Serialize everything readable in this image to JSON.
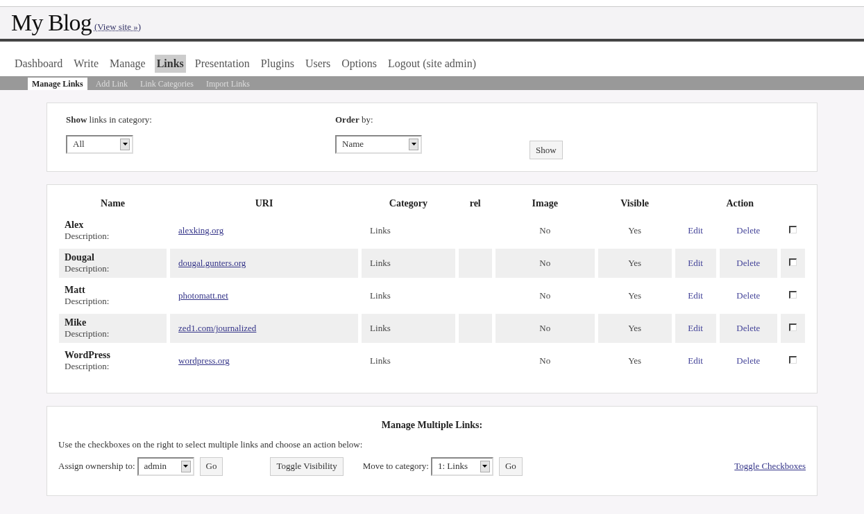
{
  "header": {
    "title": "My Blog",
    "view_site_link": "(View site »)"
  },
  "nav": [
    {
      "label": "Dashboard",
      "selected": false
    },
    {
      "label": "Write",
      "selected": false
    },
    {
      "label": "Manage",
      "selected": false
    },
    {
      "label": "Links",
      "selected": true
    },
    {
      "label": "Presentation",
      "selected": false
    },
    {
      "label": "Plugins",
      "selected": false
    },
    {
      "label": "Users",
      "selected": false
    },
    {
      "label": "Options",
      "selected": false
    },
    {
      "label": "Logout (site admin)",
      "selected": false
    }
  ],
  "subnav": [
    {
      "label": "Manage Links",
      "selected": true
    },
    {
      "label": "Add Link",
      "selected": false
    },
    {
      "label": "Link Categories",
      "selected": false
    },
    {
      "label": "Import Links",
      "selected": false
    }
  ],
  "filter": {
    "category_label": "**Show** links in category:",
    "category_value": "All",
    "order_label": "**Order** by:",
    "order_value": "Name",
    "button": "Show"
  },
  "table": {
    "columns": [
      "Name",
      "URI",
      "Category",
      "rel",
      "Image",
      "Visible",
      "Action"
    ],
    "rows": [
      {
        "name": "Alex",
        "description": "Description:",
        "uri": "alexking.org",
        "category": "Links",
        "image": "No",
        "visible": "Yes",
        "edit": "Edit",
        "delete": "Delete",
        "checked": false
      },
      {
        "name": "Dougal",
        "description": "Description:",
        "uri": "dougal.gunters.org",
        "category": "Links",
        "image": "No",
        "visible": "Yes",
        "edit": "Edit",
        "delete": "Delete",
        "checked": false
      },
      {
        "name": "Matt",
        "description": "Description:",
        "uri": "photomatt.net",
        "category": "Links",
        "image": "No",
        "visible": "Yes",
        "edit": "Edit",
        "delete": "Delete",
        "checked": false
      },
      {
        "name": "Mike",
        "description": "Description:",
        "uri": "zed1.com/journalized",
        "category": "Links",
        "image": "No",
        "visible": "Yes",
        "edit": "Edit",
        "delete": "Delete",
        "checked": false
      },
      {
        "name": "WordPress",
        "description": "Description:",
        "uri": "wordpress.org",
        "category": "Links",
        "image": "No",
        "visible": "Yes",
        "edit": "Edit",
        "delete": "Delete",
        "checked": false
      }
    ]
  },
  "bulk": {
    "title": "Manage Multiple Links:",
    "instructions": "Use the checkboxes on the right to select multiple links and choose an action below:",
    "owner_label": "Assign ownership to:",
    "owner_value": "admin",
    "go": "Go",
    "toggle_visibility": "Toggle Visibility",
    "move_label": "Move to category:",
    "move_value": "1: Links",
    "go2": "Go",
    "toggle_checkboxes": "Toggle Checkboxes"
  }
}
